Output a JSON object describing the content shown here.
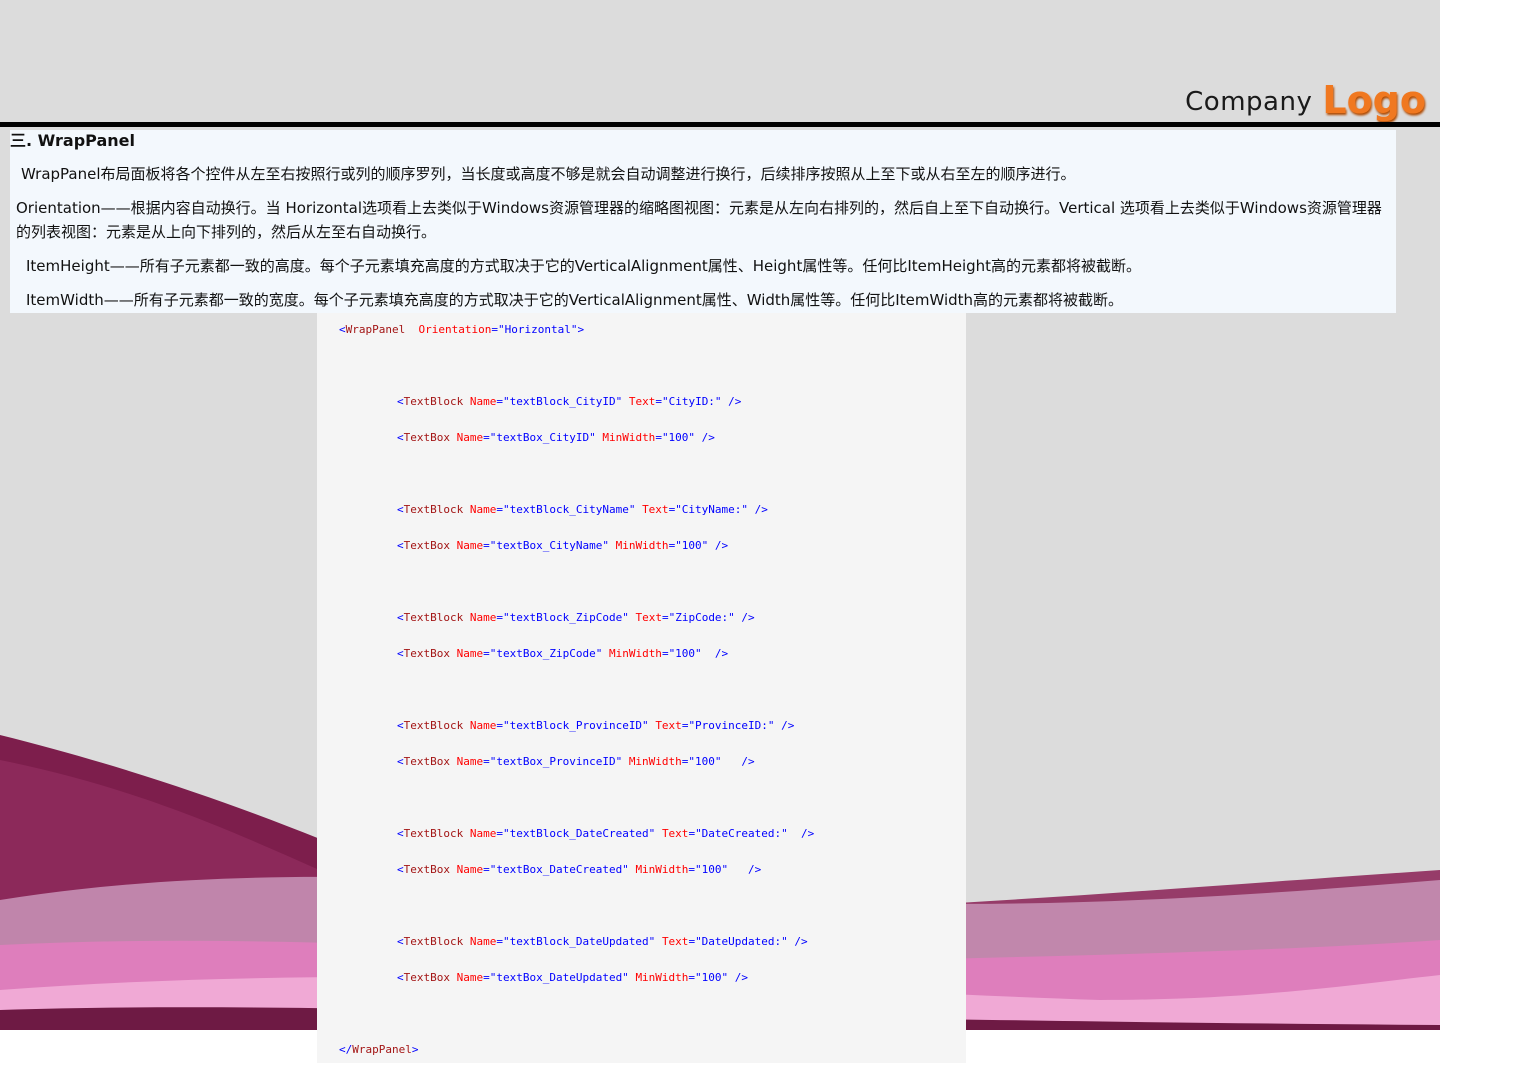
{
  "logo": {
    "company_text": "Company",
    "logo_text": "Logo",
    "accent_color": "#f07820"
  },
  "section": {
    "title": "三. WrapPanel",
    "paragraphs": [
      "WrapPanel布局面板将各个控件从左至右按照行或列的顺序罗列，当长度或高度不够是就会自动调整进行换行，后续排序按照从上至下或从右至左的顺序进行。",
      "Orientation——根据内容自动换行。当 Horizontal选项看上去类似于Windows资源管理器的缩略图视图：元素是从左向右排列的，然后自上至下自动换行。Vertical 选项看上去类似于Windows资源管理器的列表视图：元素是从上向下排列的，然后从左至右自动换行。",
      "ItemHeight——所有子元素都一致的高度。每个子元素填充高度的方式取决于它的VerticalAlignment属性、Height属性等。任何比ItemHeight高的元素都将被截断。",
      "ItemWidth——所有子元素都一致的宽度。每个子元素填充高度的方式取决于它的VerticalAlignment属性、Width属性等。任何比ItemWidth高的元素都将被截断。"
    ]
  },
  "code": {
    "open": {
      "lt": "<",
      "tag": "WrapPanel",
      "sp": "  ",
      "attr": "Orientation",
      "eq": "=",
      "val": "\"Horizontal\"",
      "gt": ">"
    },
    "lines": [
      {
        "tag": "TextBlock",
        "a1": "Name",
        "v1": "\"textBlock_CityID\"",
        "a2": "Text",
        "v2": "\"CityID:\"",
        "end": " />"
      },
      {
        "tag": "TextBox",
        "a1": "Name",
        "v1": "\"textBox_CityID\"",
        "a2": "MinWidth",
        "v2": "\"100\"",
        "end": " />"
      },
      {
        "tag": "TextBlock",
        "a1": "Name",
        "v1": "\"textBlock_CityName\"",
        "a2": "Text",
        "v2": "\"CityName:\"",
        "end": " />"
      },
      {
        "tag": "TextBox",
        "a1": "Name",
        "v1": "\"textBox_CityName\"",
        "a2": "MinWidth",
        "v2": "\"100\"",
        "end": " />"
      },
      {
        "tag": "TextBlock",
        "a1": "Name",
        "v1": "\"textBlock_ZipCode\"",
        "a2": "Text",
        "v2": "\"ZipCode:\"",
        "end": " />"
      },
      {
        "tag": "TextBox",
        "a1": "Name",
        "v1": "\"textBox_ZipCode\"",
        "a2": "MinWidth",
        "v2": "\"100\"",
        "end": "  />"
      },
      {
        "tag": "TextBlock",
        "a1": "Name",
        "v1": "\"textBlock_ProvinceID\"",
        "a2": "Text",
        "v2": "\"ProvinceID:\"",
        "end": " />"
      },
      {
        "tag": "TextBox",
        "a1": "Name",
        "v1": "\"textBox_ProvinceID\"",
        "a2": "MinWidth",
        "v2": "\"100\"",
        "end": "   />"
      },
      {
        "tag": "TextBlock",
        "a1": "Name",
        "v1": "\"textBlock_DateCreated\"",
        "a2": "Text",
        "v2": "\"DateCreated:\"",
        "end": "  />"
      },
      {
        "tag": "TextBox",
        "a1": "Name",
        "v1": "\"textBox_DateCreated\"",
        "a2": "MinWidth",
        "v2": "\"100\"",
        "end": "   />"
      },
      {
        "tag": "TextBlock",
        "a1": "Name",
        "v1": "\"textBlock_DateUpdated\"",
        "a2": "Text",
        "v2": "\"DateUpdated:\"",
        "end": " />"
      },
      {
        "tag": "TextBox",
        "a1": "Name",
        "v1": "\"textBox_DateUpdated\"",
        "a2": "MinWidth",
        "v2": "\"100\"",
        "end": " />"
      }
    ],
    "close": {
      "lt": "</",
      "tag": "WrapPanel",
      "gt": ">"
    }
  }
}
